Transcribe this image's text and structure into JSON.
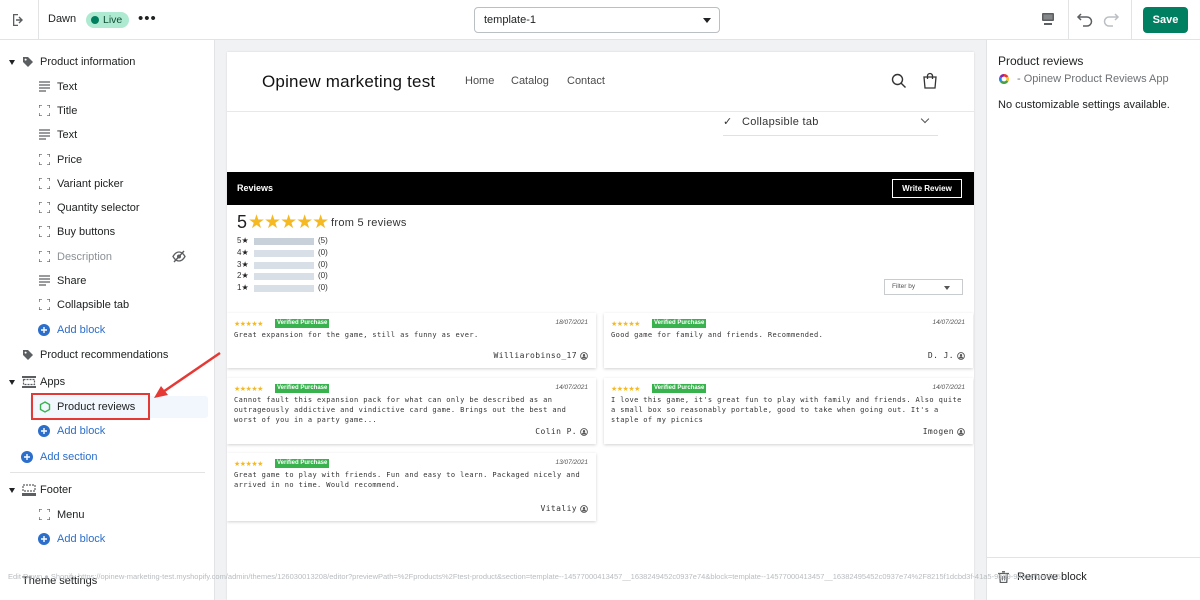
{
  "topbar": {
    "theme_name": "Dawn",
    "live_badge": "Live",
    "more": "•••",
    "template_select": "template-1",
    "save_label": "Save"
  },
  "sidebar": {
    "product_information": "Product information",
    "blocks": [
      "Text",
      "Title",
      "Text",
      "Price",
      "Variant picker",
      "Quantity selector",
      "Buy buttons",
      "Description",
      "Share",
      "Collapsible tab"
    ],
    "add_block": "Add block",
    "product_recommendations": "Product recommendations",
    "apps": "Apps",
    "product_reviews": "Product reviews",
    "add_section": "Add section",
    "footer": "Footer",
    "menu": "Menu",
    "theme_settings": "Theme settings"
  },
  "url_overlay": "Edit Dawn ● Shopify https://opinew-marketing-test.myshopify.com/admin/themes/126030013208/editor?previewPath=%2Fproducts%2Ftest-product&section=template--14577000413457__1638249452c0937e74&block=template--14577000413457__16382495452c0937e74%2F8215f1dcbd3f-41a5-9bd9-9491cfbeeb75",
  "preview": {
    "brand": "Opinew marketing test",
    "nav": [
      "Home",
      "Catalog",
      "Contact"
    ],
    "collapsible_tab": "Collapsible tab",
    "reviews": {
      "title": "Reviews",
      "write_review": "Write Review",
      "average": "5",
      "from_text": "from 5 reviews",
      "distribution": [
        {
          "label": "5",
          "count": "(5)",
          "fraction": 1
        },
        {
          "label": "4",
          "count": "(0)",
          "fraction": 0
        },
        {
          "label": "3",
          "count": "(0)",
          "fraction": 0
        },
        {
          "label": "2",
          "count": "(0)",
          "fraction": 0
        },
        {
          "label": "1",
          "count": "(0)",
          "fraction": 0
        }
      ],
      "filter_label": "Filter by",
      "verified": "Verified Purchase",
      "items": [
        {
          "date": "18/07/2021",
          "text": "Great expansion for the game, still as funny as ever.",
          "author": "Williarobinso_17"
        },
        {
          "date": "14/07/2021",
          "text": "Good game for family and friends. Recommended.",
          "author": "D. J."
        },
        {
          "date": "14/07/2021",
          "text": "Cannot fault this expansion pack for what can only be described as an outrageously addictive and vindictive card game. Brings out the best and worst of you in a party game...",
          "author": "Colin P."
        },
        {
          "date": "14/07/2021",
          "text": "I love this game, it's great fun to play with family and friends. Also quite a small box so reasonably portable, good to take when going out. It's a staple of my picnics",
          "author": "Imogen"
        },
        {
          "date": "13/07/2021",
          "text": "Great game to play with friends. Fun and easy to learn. Packaged nicely and arrived in no time. Would recommend.",
          "author": "Vitaliy"
        }
      ]
    }
  },
  "right_panel": {
    "title": "Product reviews",
    "app_name": "- Opinew Product Reviews App",
    "note": "No customizable settings available.",
    "remove_block": "Remove block"
  }
}
